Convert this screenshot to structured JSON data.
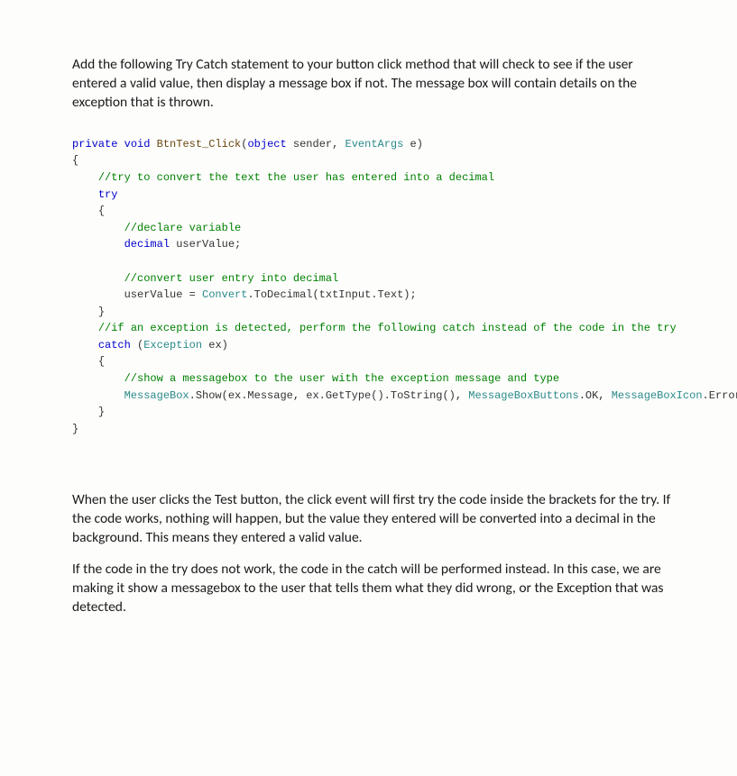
{
  "intro_paragraph": "Add the following Try Catch statement to your button click method that will check to see if the user entered a valid value, then display a message box if not. The message box will contain details on the exception that is thrown.",
  "followup_paragraph_1": "When the user clicks the Test button, the click event will first try the code inside the brackets for the try. If the code works, nothing will happen, but the value they entered will be converted into a decimal in the background. This means they entered a valid value.",
  "followup_paragraph_2": "If the code in the try does not work, the code in the catch will be performed instead. In this case, we are making it show a messagebox to the user that tells them what they did wrong, or the Exception that was detected.",
  "code": {
    "l1_private": "private",
    "l1_void": "void",
    "l1_method": "BtnTest_Click",
    "l1_object": "object",
    "l1_sender": " sender",
    "l1_comma": ", ",
    "l1_eventargs": "EventArgs",
    "l1_e": " e)",
    "l2_brace": "{",
    "l3_cmt": "//try to convert the text the user has entered into a decimal",
    "l4_try": "try",
    "l5_brace": "{",
    "l6_cmt": "//declare variable",
    "l7_decimal": "decimal",
    "l7_var": " userValue;",
    "l8_blank": "",
    "l9_cmt": "//convert user entry into decimal",
    "l10_lhs": "userValue = ",
    "l10_convert": "Convert",
    "l10_rest": ".ToDecimal(txtInput.Text);",
    "l11_brace": "}",
    "l12_cmt": "//if an exception is detected, perform the following catch instead of the code in the try",
    "l13_catch": "catch",
    "l13_open": " (",
    "l13_exception": "Exception",
    "l13_ex": " ex)",
    "l14_brace": "{",
    "l15_cmt": "//show a messagebox to the user with the exception message and type",
    "l16_msgbox": "MessageBox",
    "l16_a": ".Show(ex.Message, ex.GetType().ToString(), ",
    "l16_mbb": "MessageBoxButtons",
    "l16_b": ".OK, ",
    "l16_mbi": "MessageBoxIcon",
    "l16_c": ".Error);",
    "l17_brace": "}",
    "l18_brace": "}"
  }
}
